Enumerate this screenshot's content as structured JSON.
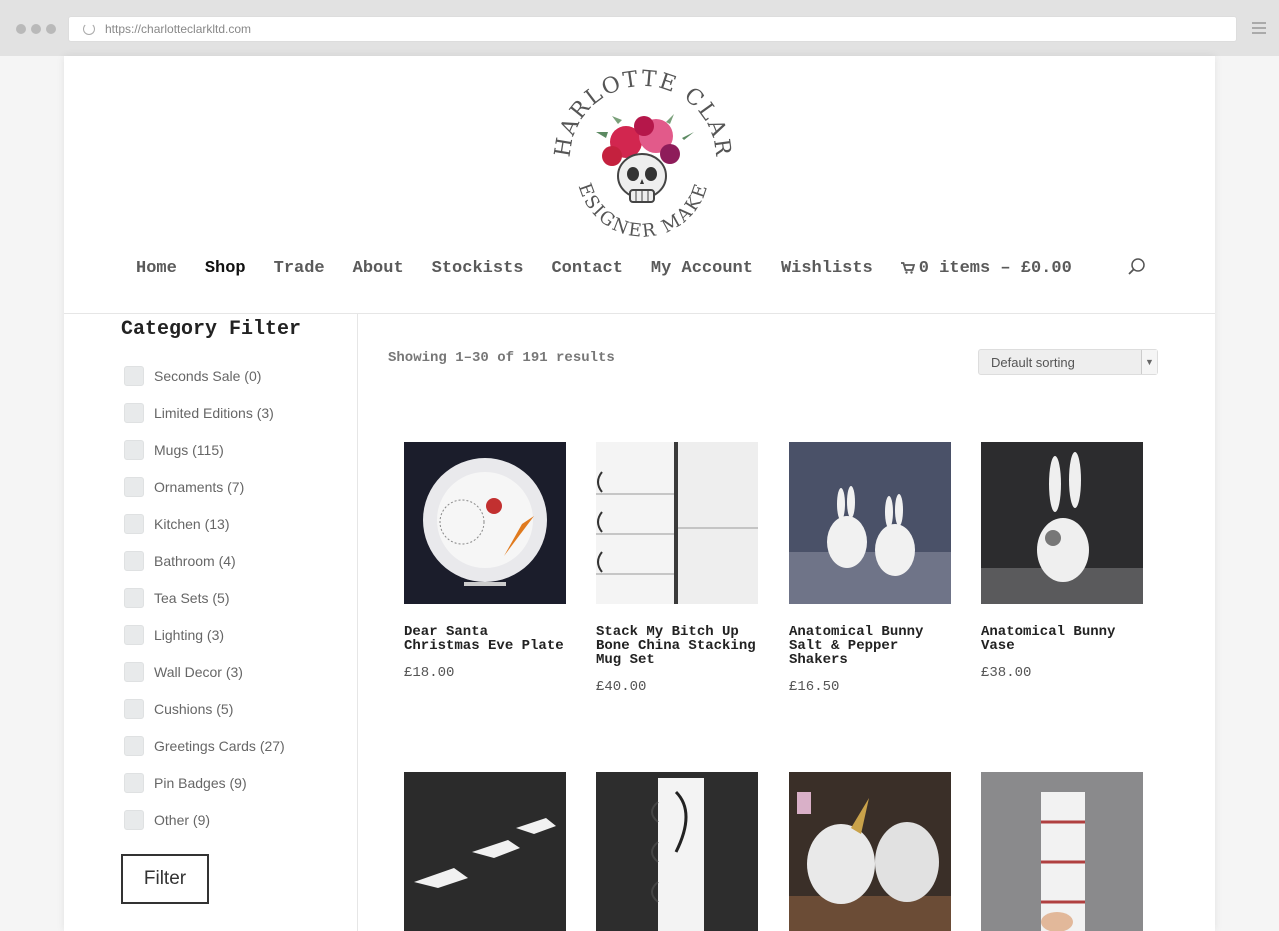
{
  "browser": {
    "url": "https://charlotteclarkltd.com"
  },
  "brand": {
    "logo_line1": "CHARLOTTE CLARK",
    "logo_line2": "DESIGNER MAKER"
  },
  "nav": {
    "items": [
      {
        "label": "Home",
        "active": false
      },
      {
        "label": "Shop",
        "active": true
      },
      {
        "label": "Trade",
        "active": false
      },
      {
        "label": "About",
        "active": false
      },
      {
        "label": "Stockists",
        "active": false
      },
      {
        "label": "Contact",
        "active": false
      },
      {
        "label": "My Account",
        "active": false
      },
      {
        "label": "Wishlists",
        "active": false
      }
    ],
    "cart_label": "0 items – £0.00",
    "cart_icon": "cart-icon",
    "search_icon": "search-icon"
  },
  "sidebar": {
    "title": "Category Filter",
    "categories": [
      "Seconds Sale (0)",
      "Limited Editions (3)",
      "Mugs (115)",
      "Ornaments (7)",
      "Kitchen (13)",
      "Bathroom (4)",
      "Tea Sets (5)",
      "Lighting (3)",
      "Wall Decor (3)",
      "Cushions (5)",
      "Greetings Cards (27)",
      "Pin Badges (9)",
      "Other (9)"
    ],
    "filter_button": "Filter"
  },
  "shop": {
    "results_text": "Showing 1–30 of 191 results",
    "sort_selected": "Default sorting",
    "products": [
      {
        "name": "Dear Santa Christmas Eve Plate",
        "price": "£18.00"
      },
      {
        "name": "Stack My Bitch Up Bone China Stacking Mug Set",
        "price": "£40.00"
      },
      {
        "name": "Anatomical Bunny Salt & Pepper Shakers",
        "price": "£16.50"
      },
      {
        "name": "Anatomical Bunny Vase",
        "price": "£38.00"
      },
      {
        "name": "",
        "price": ""
      },
      {
        "name": "",
        "price": ""
      },
      {
        "name": "",
        "price": ""
      },
      {
        "name": "",
        "price": ""
      }
    ]
  },
  "colors": {
    "accent_text": "#222222",
    "nav_text": "#5a5a5a",
    "checkbox_bg": "#e8eaeb"
  }
}
